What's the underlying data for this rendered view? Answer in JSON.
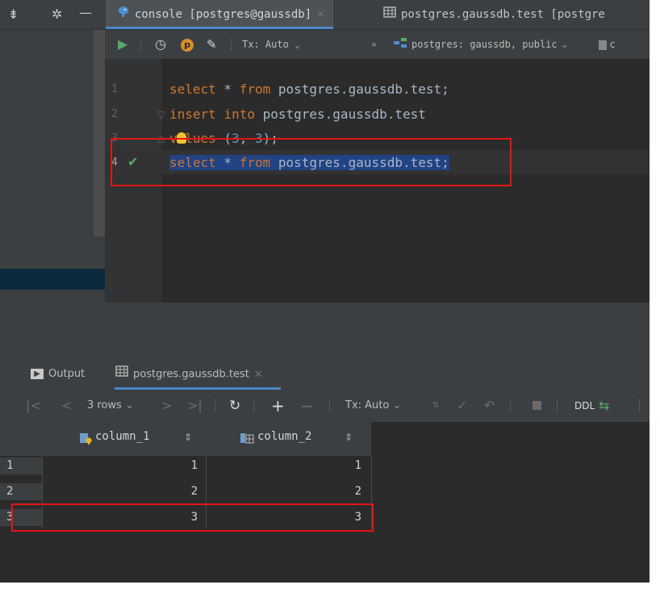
{
  "tabs": [
    {
      "label": "console [postgres@gaussdb]",
      "active": true
    },
    {
      "label": "postgres.gaussdb.test [postgre",
      "active": false
    }
  ],
  "toolbar": {
    "tx_label": "Tx: Auto",
    "more": "»",
    "datasource": "postgres: gaussdb, public",
    "extra": "c"
  },
  "editor": {
    "line_numbers": [
      "1",
      "2",
      "3",
      "4"
    ],
    "lines": [
      {
        "kw1": "select",
        "rest": " * ",
        "kw2": "from",
        "tail": " postgres.gaussdb.test;"
      },
      {
        "kw1": "insert",
        "rest": " ",
        "kw2": "into",
        "tail": " postgres.gaussdb.test"
      },
      {
        "kw1": "values",
        "rest": " (",
        "n1": "3",
        "comma": ", ",
        "n2": "3",
        "tail": ");"
      },
      {
        "kw1": "select",
        "rest": " * ",
        "kw2": "from",
        "tail": " postgres.gaussdb.test;"
      }
    ]
  },
  "output_tabs": {
    "output": "Output",
    "result": "postgres.gaussdb.test"
  },
  "result_toolbar": {
    "rows": "3 rows",
    "tx_label": "Tx: Auto",
    "ddl": "DDL"
  },
  "grid": {
    "columns": [
      "column_1",
      "column_2"
    ],
    "rows": [
      {
        "n": "1",
        "c1": "1",
        "c2": "1"
      },
      {
        "n": "2",
        "c1": "2",
        "c2": "2"
      },
      {
        "n": "3",
        "c1": "3",
        "c2": "3"
      }
    ]
  },
  "colors": {
    "keyword": "#cc7832",
    "number": "#6897bb",
    "selection": "#214283",
    "highlight": "#e51414"
  }
}
